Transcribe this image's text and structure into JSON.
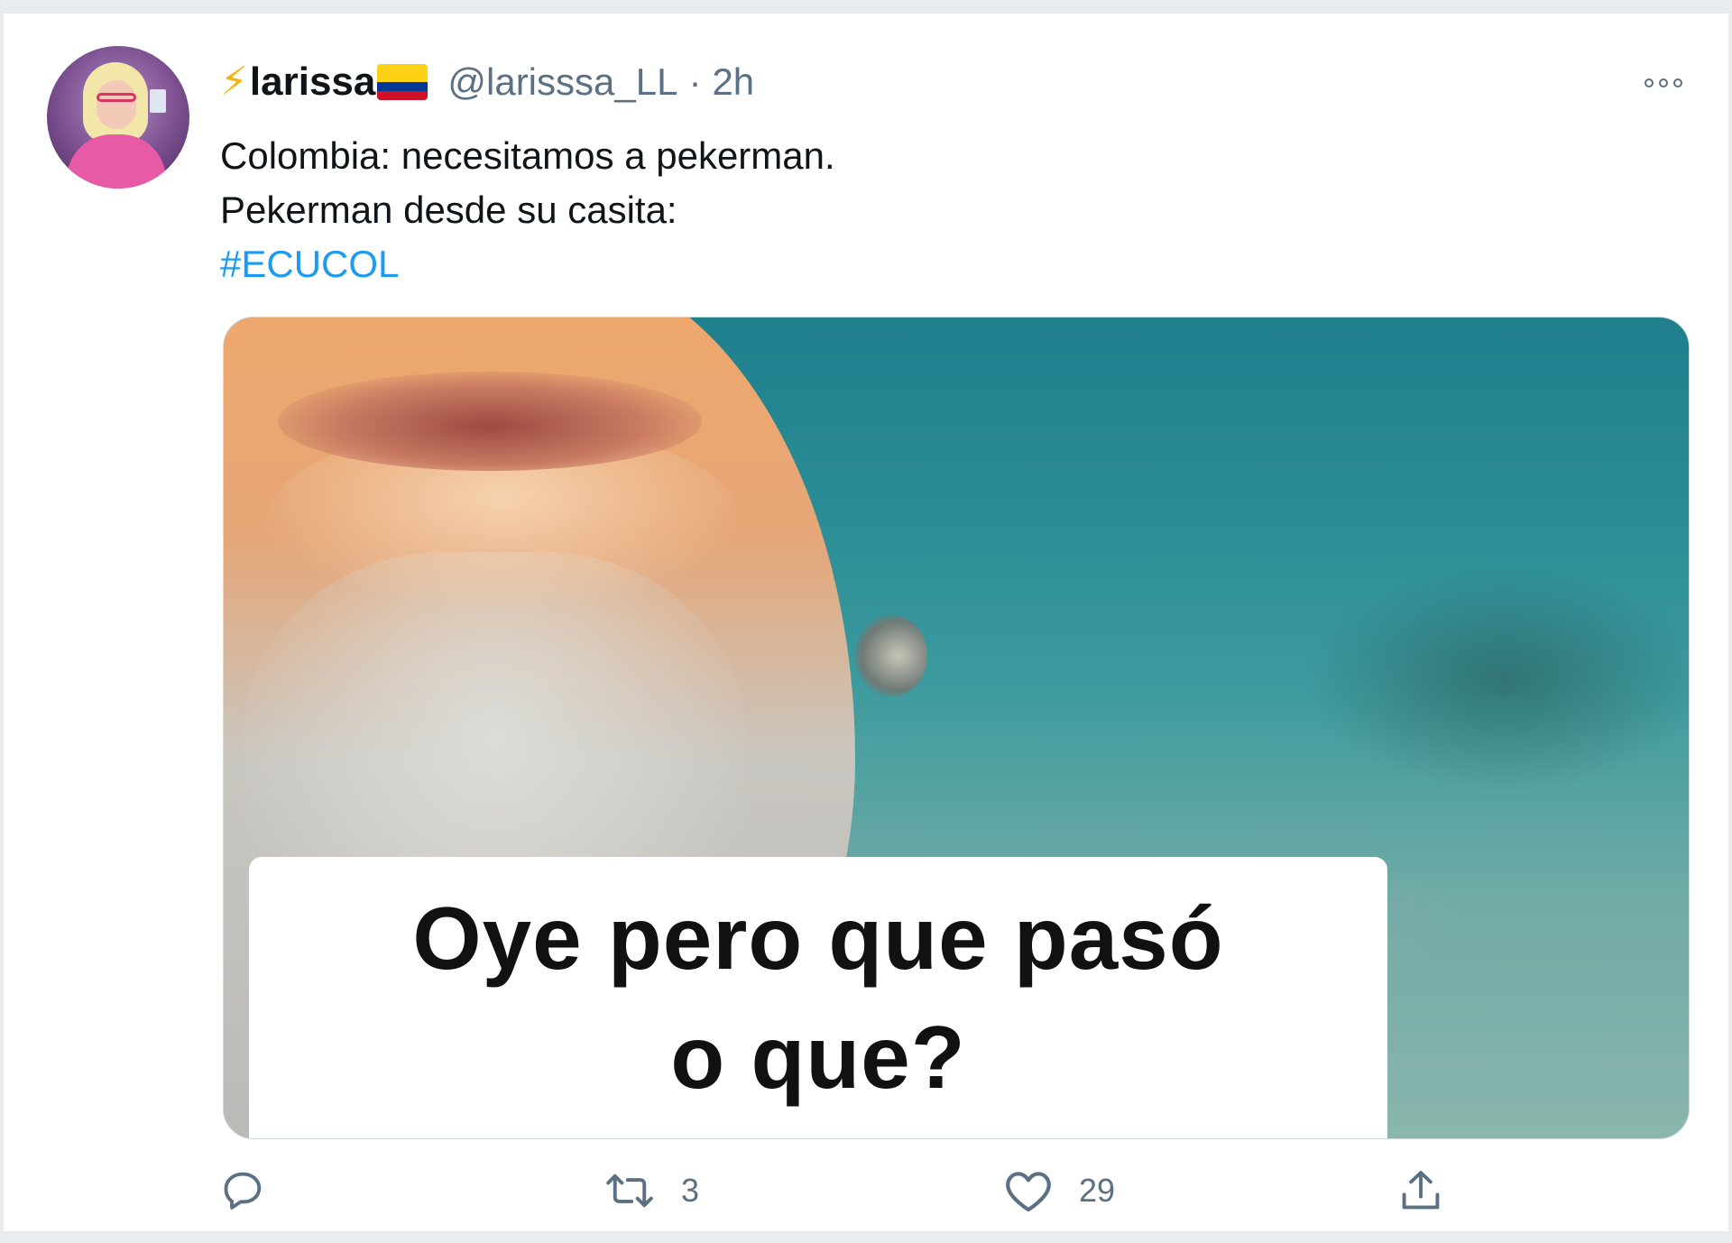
{
  "tweet": {
    "author": {
      "display_name": "larissa",
      "name_prefix_emoji": "⚡",
      "name_suffix_flag": "colombia-flag",
      "handle": "@larisssa_LL",
      "timestamp": "2h",
      "separator": "·"
    },
    "text_lines": [
      "Colombia: necesitamos a pekerman.",
      "Pekerman desde su casita:"
    ],
    "hashtag": "#ECUCOL",
    "media": {
      "caption_line1": "Oye pero que pasó",
      "caption_line2": "o que?"
    },
    "actions": {
      "reply_count": "",
      "retweet_count": "3",
      "like_count": "29"
    }
  },
  "colors": {
    "link": "#1d9bf0",
    "secondary_text": "#5b7083",
    "primary_text": "#0f1419"
  },
  "icons": [
    "more-icon",
    "reply-icon",
    "retweet-icon",
    "like-icon",
    "share-icon",
    "bolt-icon",
    "colombia-flag-icon"
  ]
}
